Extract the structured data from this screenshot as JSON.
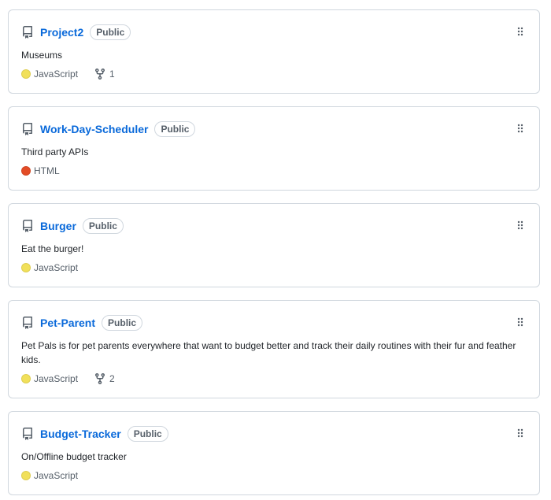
{
  "colors": {
    "link": "#0969da",
    "javascript": "#f1e05a",
    "html": "#e34c26"
  },
  "repos": [
    {
      "name": "Project2",
      "visibility": "Public",
      "description": "Museums",
      "language": "JavaScript",
      "language_color": "#f1e05a",
      "forks": "1",
      "icon": "repo-icon"
    },
    {
      "name": "Work-Day-Scheduler",
      "visibility": "Public",
      "description": "Third party APIs",
      "language": "HTML",
      "language_color": "#e34c26",
      "forks": null,
      "icon": "repo-icon"
    },
    {
      "name": "Burger",
      "visibility": "Public",
      "description": "Eat the burger!",
      "language": "JavaScript",
      "language_color": "#f1e05a",
      "forks": null,
      "icon": "repo-icon"
    },
    {
      "name": "Pet-Parent",
      "visibility": "Public",
      "description": "Pet Pals is for pet parents everywhere that want to budget better and track their daily routines with their fur and feather kids.",
      "language": "JavaScript",
      "language_color": "#f1e05a",
      "forks": "2",
      "icon": "repo-icon"
    },
    {
      "name": "Budget-Tracker",
      "visibility": "Public",
      "description": "On/Offline budget tracker",
      "language": "JavaScript",
      "language_color": "#f1e05a",
      "forks": null,
      "icon": "repo-icon"
    }
  ]
}
